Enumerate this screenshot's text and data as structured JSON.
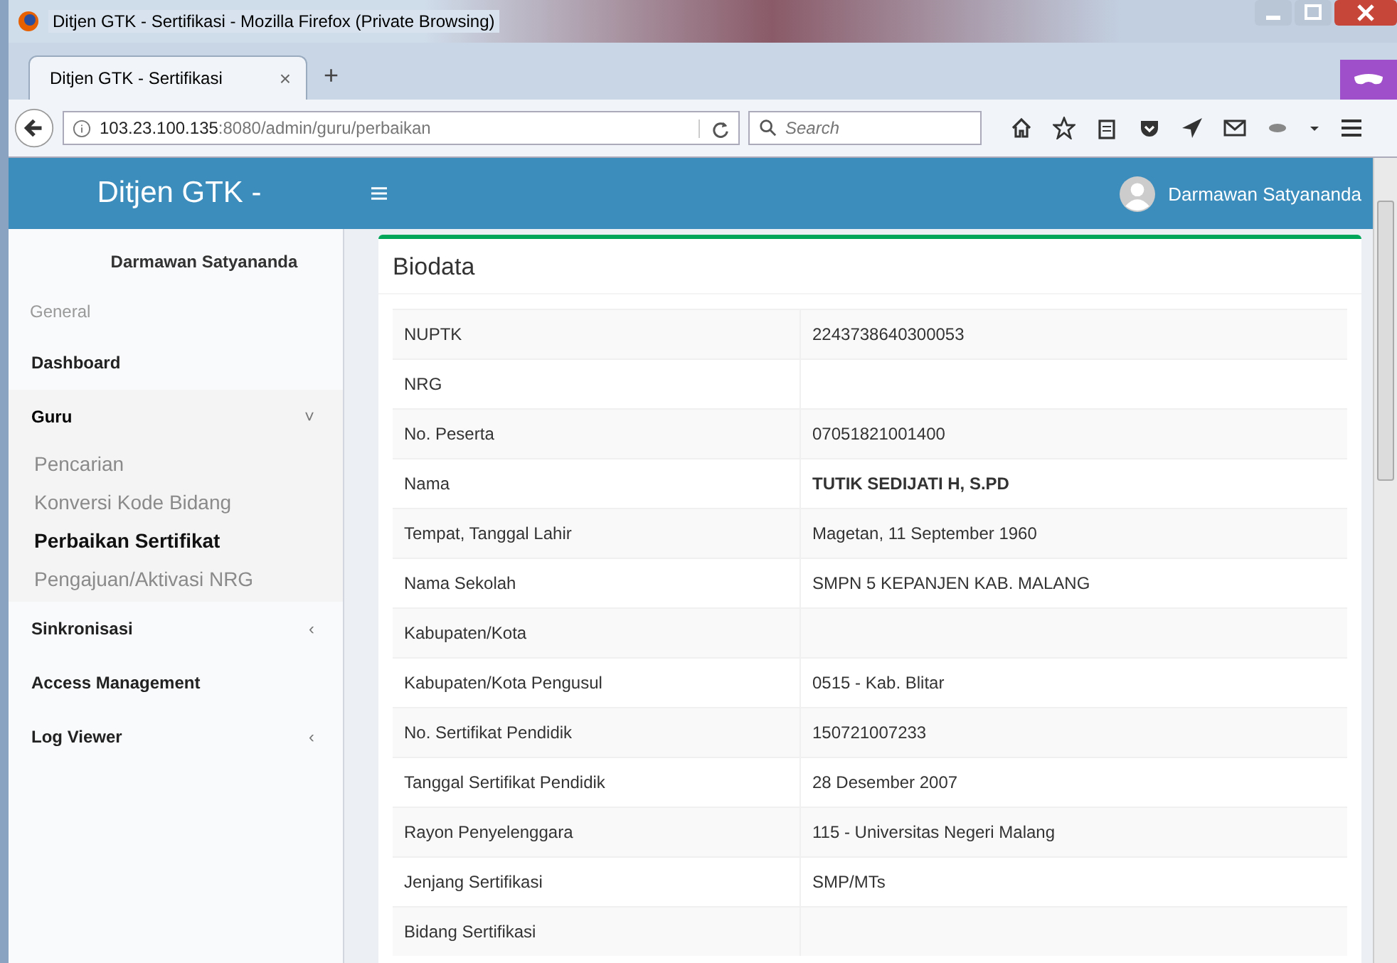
{
  "window": {
    "title": "Ditjen GTK - Sertifikasi - Mozilla Firefox (Private Browsing)"
  },
  "tabs": [
    {
      "label": "Ditjen GTK - Sertifikasi",
      "selected": true,
      "close": "×"
    }
  ],
  "new_tab": "+",
  "address_bar": {
    "host": "103.23.100.135",
    "rest": ":8080/admin/guru/perbaikan"
  },
  "search": {
    "placeholder": "Search"
  },
  "header": {
    "brand": "Ditjen GTK -",
    "user": "Darmawan Satyananda"
  },
  "sidebar": {
    "user": "Darmawan Satyananda",
    "section": "General",
    "items": [
      {
        "label": "Dashboard"
      },
      {
        "label": "Guru",
        "expanded": true,
        "caret": "˅",
        "children": [
          {
            "label": "Pencarian",
            "selected": false
          },
          {
            "label": "Konversi Kode Bidang",
            "selected": false
          },
          {
            "label": "Perbaikan Sertifikat",
            "selected": true
          },
          {
            "label": "Pengajuan/Aktivasi NRG",
            "selected": false
          }
        ]
      },
      {
        "label": "Sinkronisasi",
        "expanded": false,
        "caret": "‹"
      },
      {
        "label": "Access Management"
      },
      {
        "label": "Log Viewer",
        "expanded": false,
        "caret": "‹"
      }
    ]
  },
  "card": {
    "title": "Biodata",
    "rows": [
      {
        "label": "NUPTK",
        "value": "2243738640300053",
        "bold": false
      },
      {
        "label": "NRG"
      },
      {
        "label": "No. Peserta",
        "value": "07051821001400",
        "bold": false
      },
      {
        "label": "Nama",
        "value": "TUTIK SEDIJATI H, S.PD",
        "bold": true
      },
      {
        "label": "Tempat, Tanggal Lahir",
        "value": "Magetan, 11 September 1960",
        "bold": false
      },
      {
        "label": "Nama Sekolah",
        "value": "SMPN 5 KEPANJEN KAB. MALANG",
        "bold": false
      },
      {
        "label": "Kabupaten/Kota"
      },
      {
        "label": "Kabupaten/Kota Pengusul",
        "value": "0515 - Kab. Blitar",
        "bold": false
      },
      {
        "label": "No. Sertifikat Pendidik",
        "value": "150721007233",
        "bold": false
      },
      {
        "label": "Tanggal Sertifikat Pendidik",
        "value": "28 Desember 2007",
        "bold": false
      },
      {
        "label": "Rayon Penyelenggara",
        "value": "115 - Universitas Negeri Malang",
        "bold": false
      },
      {
        "label": "Jenjang Sertifikasi",
        "value": "SMP/MTs",
        "bold": false
      },
      {
        "label": "Bidang Sertifikasi"
      }
    ]
  }
}
